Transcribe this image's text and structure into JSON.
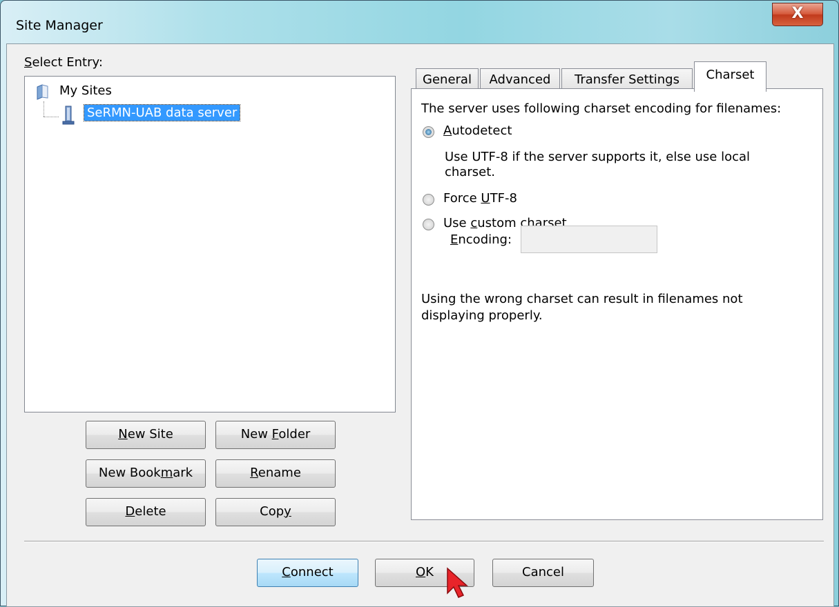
{
  "window": {
    "title": "Site Manager",
    "close_glyph": "X"
  },
  "select_entry": {
    "label_accel": "S",
    "label_rest": "elect Entry:"
  },
  "tree": {
    "root": {
      "label": "My Sites",
      "icon": "folder-icon"
    },
    "child": {
      "label": "SeRMN-UAB data server",
      "icon": "server-icon",
      "selected": true
    }
  },
  "left_buttons": {
    "new_site": {
      "accel": "N",
      "rest": "ew Site"
    },
    "new_folder": {
      "pre": "New ",
      "accel": "F",
      "rest": "older"
    },
    "new_bookmark": {
      "pre": "New Book",
      "accel": "m",
      "rest": "ark"
    },
    "rename": {
      "accel": "R",
      "rest": "ename"
    },
    "delete": {
      "accel": "D",
      "rest": "elete"
    },
    "copy": {
      "pre": "Cop",
      "accel": "y",
      "rest": ""
    }
  },
  "tabs": [
    {
      "label": "General",
      "active": false
    },
    {
      "label": "Advanced",
      "active": false
    },
    {
      "label": "Transfer Settings",
      "active": false
    },
    {
      "label": "Charset",
      "active": true
    }
  ],
  "charset": {
    "intro": "The server uses following charset encoding for filenames:",
    "autodetect": {
      "accel": "A",
      "rest": "utodetect",
      "checked": true
    },
    "autodetect_desc_1": "Use UTF-8 if the server supports it, else use local",
    "autodetect_desc_2": "charset.",
    "force_utf8": {
      "pre": "Force ",
      "accel": "U",
      "rest": "TF-8",
      "checked": false
    },
    "custom": {
      "pre": "Use ",
      "accel": "c",
      "rest": "ustom charset",
      "checked": false
    },
    "encoding": {
      "accel": "E",
      "rest": "ncoding:",
      "value": ""
    },
    "warning_1": "Using the wrong charset can result in filenames not",
    "warning_2": "displaying properly."
  },
  "bottom_buttons": {
    "connect": {
      "accel": "C",
      "rest": "onnect"
    },
    "ok": {
      "accel": "O",
      "rest": "K"
    },
    "cancel": {
      "label": "Cancel"
    }
  },
  "colors": {
    "selection": "#3399ff",
    "close_button": "#c8472a",
    "cursor": "#e8242a"
  }
}
